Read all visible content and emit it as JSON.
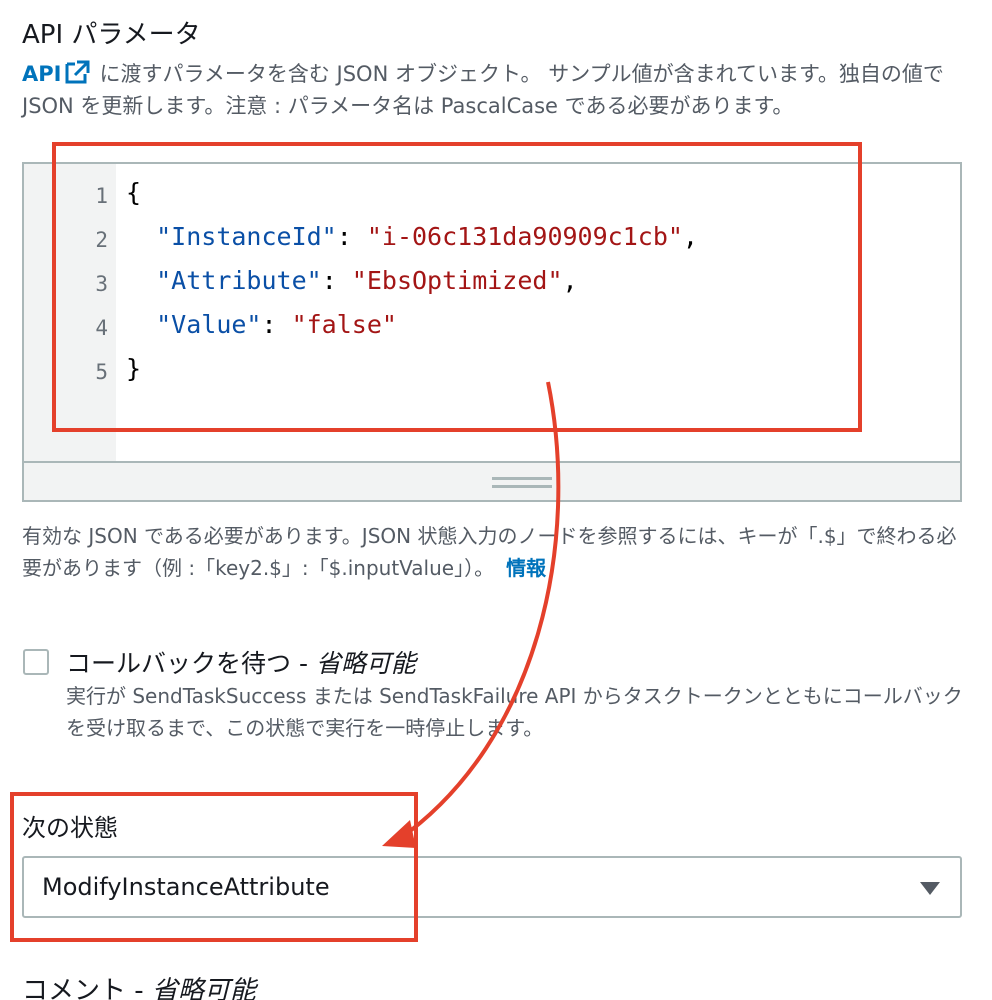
{
  "api_params": {
    "title": "API パラメータ",
    "description_link": "API",
    "description_text": "に渡すパラメータを含む JSON オブジェクト。 サンプル値が含まれています。独自の値で JSON を更新します。注意 : パラメータ名は PascalCase である必要があります。",
    "editor": {
      "line_numbers": [
        "1",
        "2",
        "3",
        "4",
        "5"
      ],
      "lines": [
        {
          "pre": "{",
          "key": "",
          "mid": "",
          "val": "",
          "post": ""
        },
        {
          "pre": "  ",
          "key": "\"InstanceId\"",
          "mid": ": ",
          "val": "\"i-06c131da90909c1cb\"",
          "post": ","
        },
        {
          "pre": "  ",
          "key": "\"Attribute\"",
          "mid": ": ",
          "val": "\"EbsOptimized\"",
          "post": ","
        },
        {
          "pre": "  ",
          "key": "\"Value\"",
          "mid": ": ",
          "val": "\"false\"",
          "post": ""
        },
        {
          "pre": "}",
          "key": "",
          "mid": "",
          "val": "",
          "post": ""
        }
      ]
    },
    "hint_text": "有効な JSON である必要があります。JSON 状態入力のノードを参照するには、キーが「.$」で終わる必要があります（例 :「key2.$」:「$.inputValue」）。",
    "hint_link": "情報"
  },
  "callback": {
    "label": "コールバックを待つ - ",
    "optional": "省略可能",
    "description": "実行が SendTaskSuccess または SendTaskFailure API からタスクトークンとともにコールバックを受け取るまで、この状態で実行を一時停止します。",
    "checked": false
  },
  "next_state": {
    "label": "次の状態",
    "selected": "ModifyInstanceAttribute"
  },
  "comment": {
    "label": "コメント - ",
    "optional": "省略可能"
  },
  "colors": {
    "annotation": "#e4402b",
    "link": "#0073bb",
    "json_key": "#0a4fa6",
    "json_string": "#a31515"
  }
}
